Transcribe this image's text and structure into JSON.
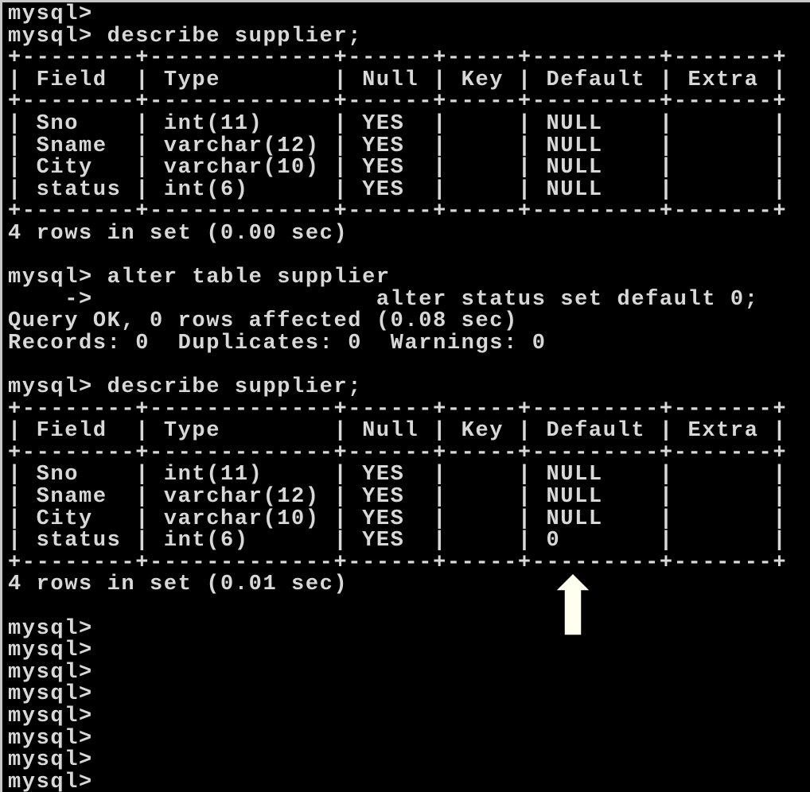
{
  "console": {
    "lines": [
      "mysql>",
      "mysql> describe supplier;",
      "+--------+-------------+------+-----+---------+-------+",
      "| Field  | Type        | Null | Key | Default | Extra |",
      "+--------+-------------+------+-----+---------+-------+",
      "| Sno    | int(11)     | YES  |     | NULL    |       |",
      "| Sname  | varchar(12) | YES  |     | NULL    |       |",
      "| City   | varchar(10) | YES  |     | NULL    |       |",
      "| status | int(6)      | YES  |     | NULL    |       |",
      "+--------+-------------+------+-----+---------+-------+",
      "4 rows in set (0.00 sec)",
      "",
      "mysql> alter table supplier",
      "    ->                    alter status set default 0;",
      "Query OK, 0 rows affected (0.08 sec)",
      "Records: 0  Duplicates: 0  Warnings: 0",
      "",
      "mysql> describe supplier;",
      "+--------+-------------+------+-----+---------+-------+",
      "| Field  | Type        | Null | Key | Default | Extra |",
      "+--------+-------------+------+-----+---------+-------+",
      "| Sno    | int(11)     | YES  |     | NULL    |       |",
      "| Sname  | varchar(12) | YES  |     | NULL    |       |",
      "| City   | varchar(10) | YES  |     | NULL    |       |",
      "| status | int(6)      | YES  |     | 0       |       |",
      "+--------+-------------+------+-----+---------+-------+",
      "4 rows in set (0.01 sec)",
      "",
      "mysql>",
      "mysql>",
      "mysql>",
      "mysql>",
      "mysql>",
      "mysql>",
      "mysql>",
      "mysql>"
    ]
  },
  "colors": {
    "background": "#000000",
    "text": "#d8d8d8",
    "arrow_fill": "#fffff0",
    "arrow_stroke": "#000000"
  },
  "annotation": {
    "icon": "up-arrow-icon"
  }
}
